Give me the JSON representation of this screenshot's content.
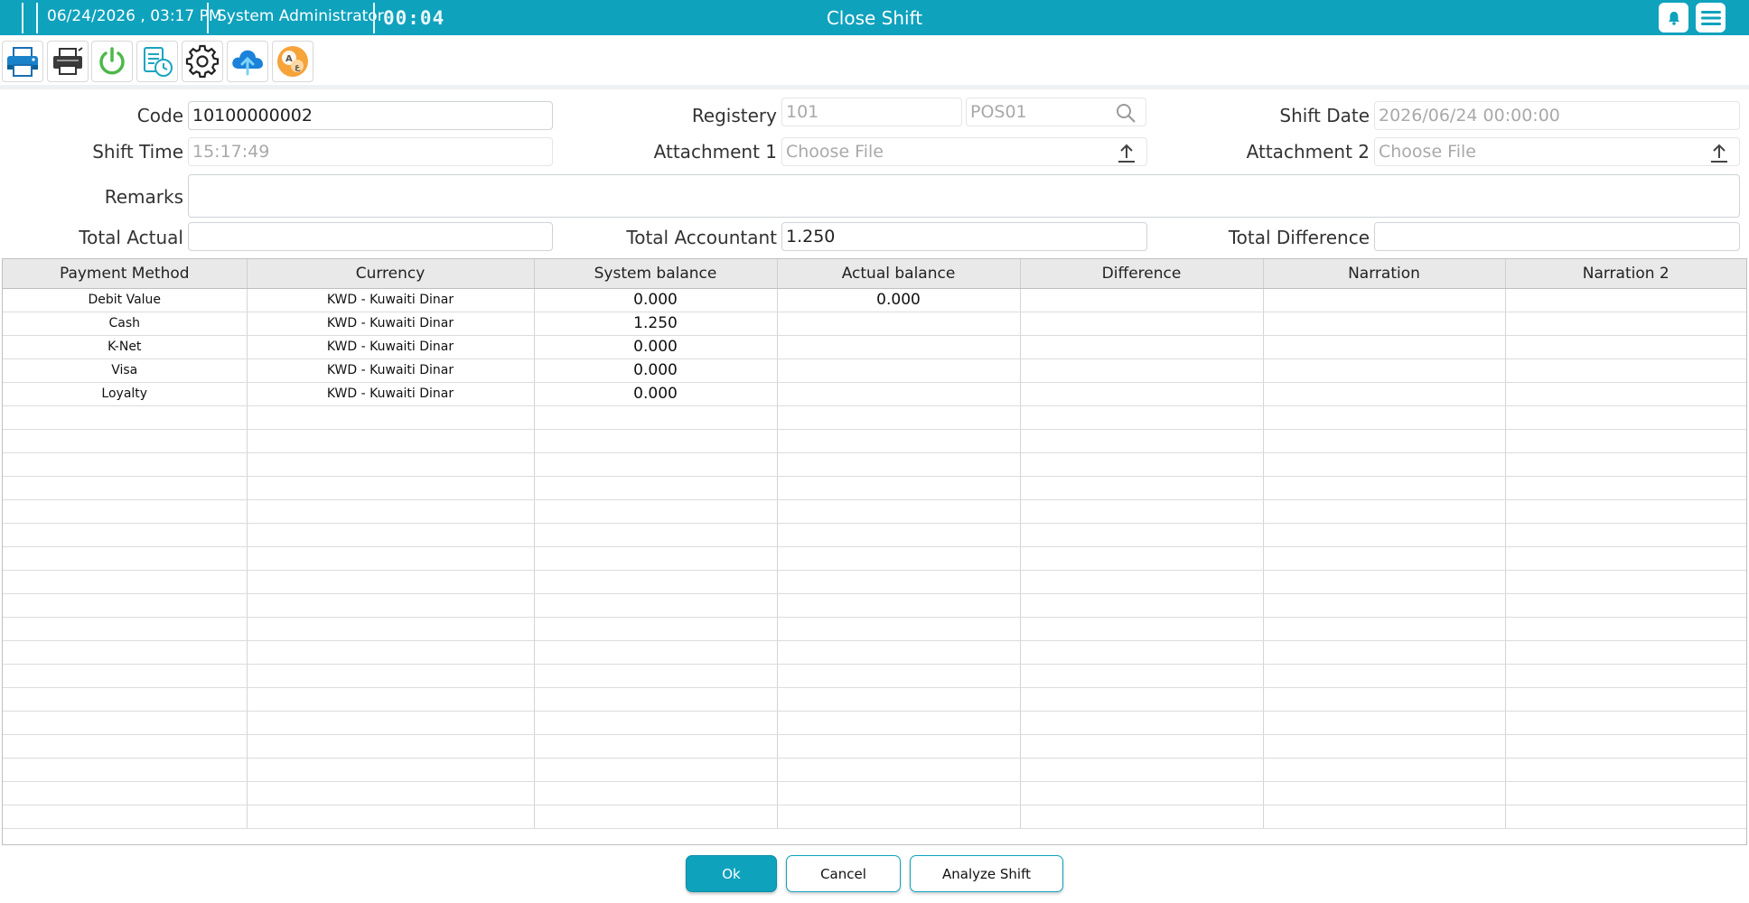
{
  "header": {
    "datetime": "06/24/2026 , 03:17 PM",
    "user": "System Administrator",
    "timer": "00:04",
    "title": "Close Shift"
  },
  "toolbar": {
    "buttons": [
      {
        "icon": "printer-icon"
      },
      {
        "icon": "receipt-printer-icon"
      },
      {
        "icon": "power-icon"
      },
      {
        "icon": "history-report-icon"
      },
      {
        "icon": "gear-icon"
      },
      {
        "icon": "cloud-upload-icon"
      },
      {
        "icon": "translate-icon"
      }
    ]
  },
  "form": {
    "code": {
      "label": "Code",
      "value": "10100000002"
    },
    "registery": {
      "label": "Registery",
      "value": "101",
      "secondary": "POS01"
    },
    "shift_date": {
      "label": "Shift Date",
      "value": "2026/06/24 00:00:00"
    },
    "shift_time": {
      "label": "Shift Time",
      "value": "15:17:49"
    },
    "attachment1": {
      "label": "Attachment 1",
      "placeholder": "Choose File"
    },
    "attachment2": {
      "label": "Attachment 2",
      "placeholder": "Choose File"
    },
    "remarks": {
      "label": "Remarks",
      "value": ""
    },
    "total_actual": {
      "label": "Total Actual",
      "value": ""
    },
    "total_accountant": {
      "label": "Total Accountant",
      "value": "1.250"
    },
    "total_difference": {
      "label": "Total Difference",
      "value": ""
    }
  },
  "table": {
    "columns": [
      "Payment Method",
      "Currency",
      "System balance",
      "Actual balance",
      "Difference",
      "Narration",
      "Narration 2"
    ],
    "rows": [
      [
        "Debit Value",
        "KWD - Kuwaiti Dinar",
        "0.000",
        "0.000",
        "",
        "",
        ""
      ],
      [
        "Cash",
        "KWD - Kuwaiti Dinar",
        "1.250",
        "",
        "",
        "",
        ""
      ],
      [
        "K-Net",
        "KWD - Kuwaiti Dinar",
        "0.000",
        "",
        "",
        "",
        ""
      ],
      [
        "Visa",
        "KWD - Kuwaiti Dinar",
        "0.000",
        "",
        "",
        "",
        ""
      ],
      [
        "Loyalty",
        "KWD - Kuwaiti Dinar",
        "0.000",
        "",
        "",
        "",
        ""
      ]
    ]
  },
  "actions": {
    "ok": "Ok",
    "cancel": "Cancel",
    "analyze": "Analyze Shift"
  },
  "colors": {
    "accent": "#0fa2bd"
  }
}
